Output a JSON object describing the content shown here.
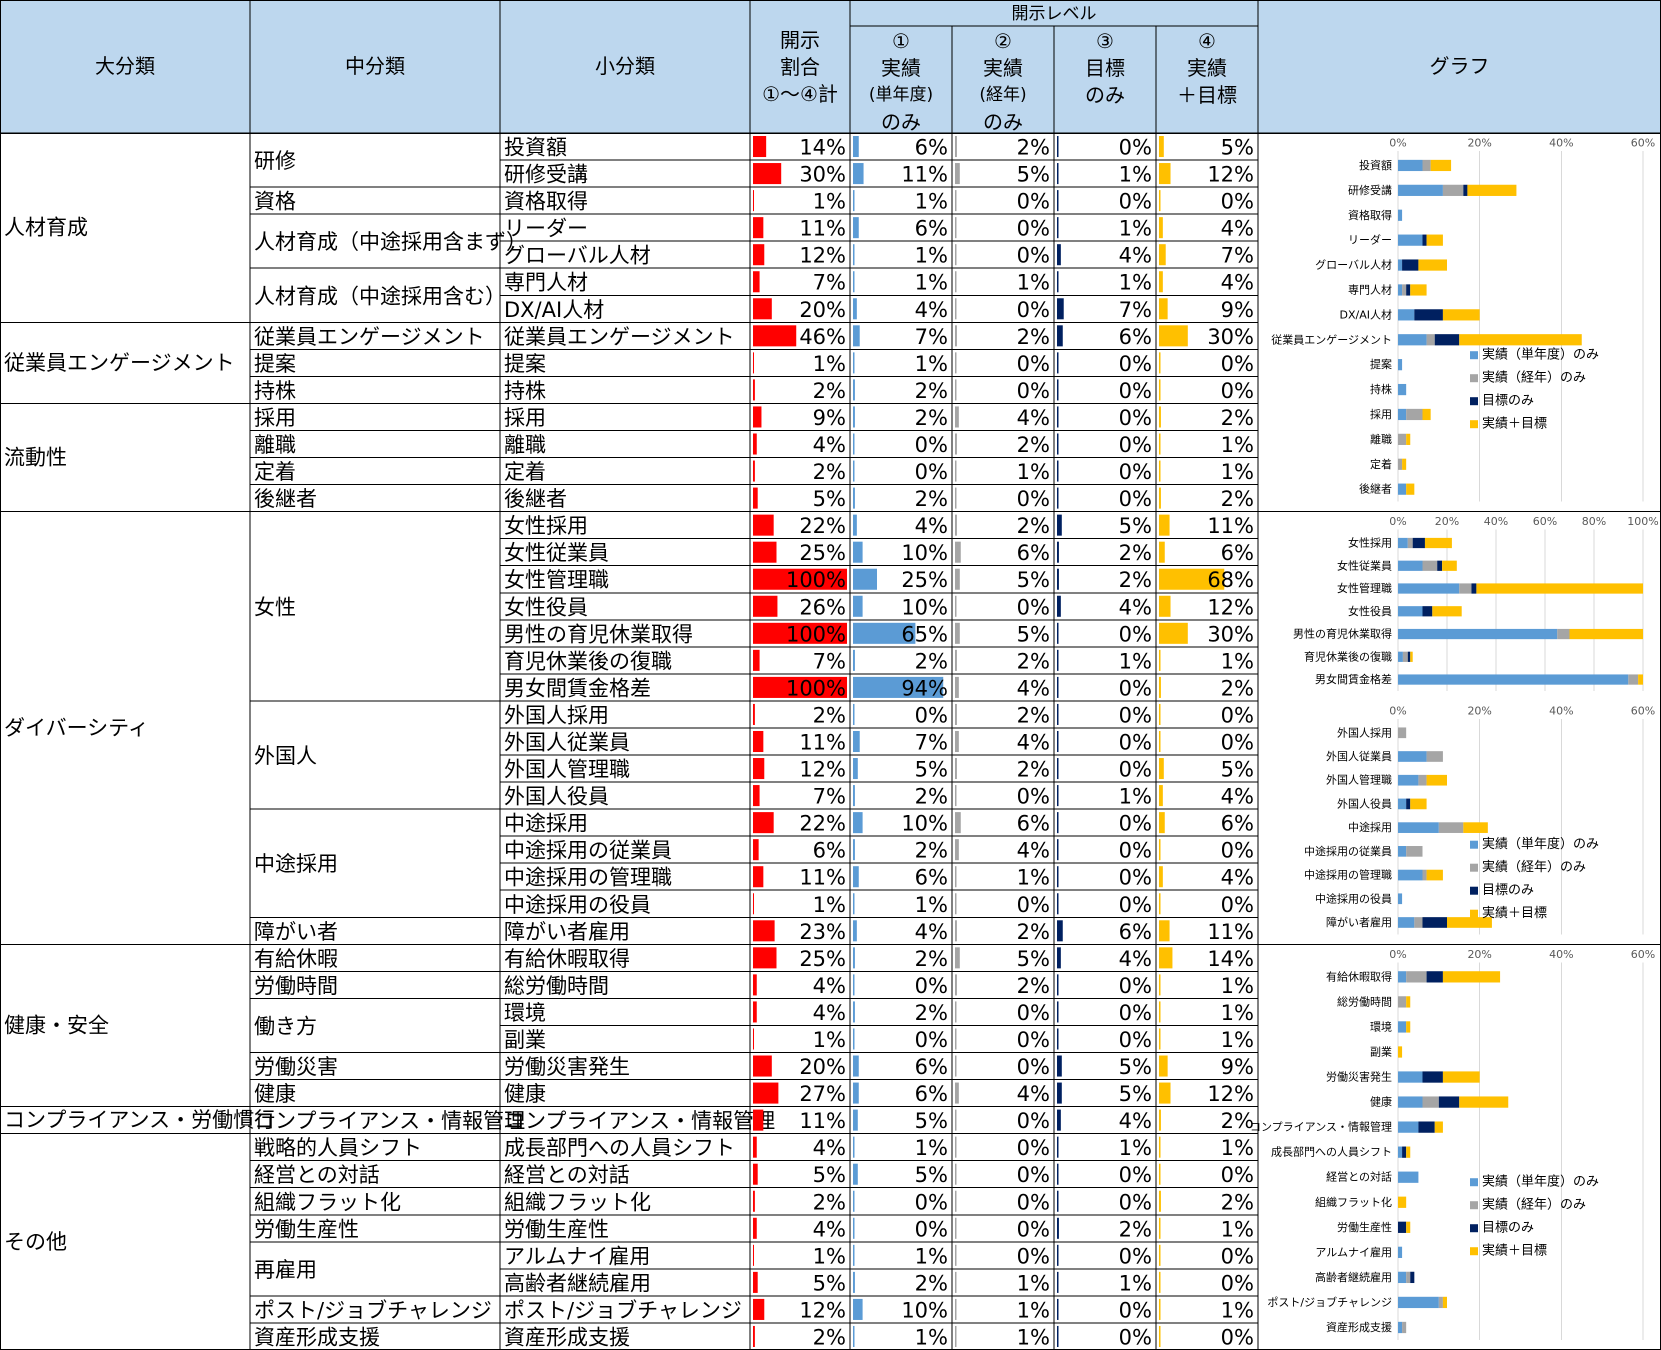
{
  "header": {
    "dai": "大分類",
    "chu": "中分類",
    "sho": "小分類",
    "ratio": [
      "開示",
      "割合",
      "①～④計"
    ],
    "level_title": "開示レベル",
    "l1": [
      "①",
      "実績",
      "(単年度)",
      "のみ"
    ],
    "l2": [
      "②",
      "実績",
      "(経年)",
      "のみ"
    ],
    "l3": [
      "③",
      "目標",
      "のみ"
    ],
    "l4": [
      "④",
      "実績",
      "＋目標"
    ],
    "graph": "グラフ"
  },
  "colors": {
    "header_bg": "#BDD7EE",
    "ratio_bar": "#FF0000",
    "s1": "#5B9BD5",
    "s2": "#A5A5A5",
    "s3": "#002060",
    "s4": "#FFC000",
    "grid": "#D9D9D9"
  },
  "dai_groups": [
    {
      "label": "人材育成",
      "start": 0,
      "span": 7
    },
    {
      "label": "従業員エンゲージメント",
      "start": 7,
      "span": 3
    },
    {
      "label": "流動性",
      "start": 10,
      "span": 4
    },
    {
      "label": "ダイバーシティ",
      "start": 14,
      "span": 16
    },
    {
      "label": "健康・安全",
      "start": 30,
      "span": 6
    },
    {
      "label": "コンプライアンス・労働慣行",
      "start": 36,
      "span": 1
    },
    {
      "label": "その他",
      "start": 37,
      "span": 8
    }
  ],
  "chu_groups": [
    {
      "label": "研修",
      "start": 0,
      "span": 2
    },
    {
      "label": "資格",
      "start": 2,
      "span": 1
    },
    {
      "label": "人材育成（中途採用含まず）",
      "start": 3,
      "span": 2
    },
    {
      "label": "人材育成（中途採用含む）",
      "start": 5,
      "span": 2
    },
    {
      "label": "従業員エンゲージメント",
      "start": 7,
      "span": 1
    },
    {
      "label": "提案",
      "start": 8,
      "span": 1
    },
    {
      "label": "持株",
      "start": 9,
      "span": 1
    },
    {
      "label": "採用",
      "start": 10,
      "span": 1
    },
    {
      "label": "離職",
      "start": 11,
      "span": 1
    },
    {
      "label": "定着",
      "start": 12,
      "span": 1
    },
    {
      "label": "後継者",
      "start": 13,
      "span": 1
    },
    {
      "label": "女性",
      "start": 14,
      "span": 7
    },
    {
      "label": "外国人",
      "start": 21,
      "span": 4
    },
    {
      "label": "中途採用",
      "start": 25,
      "span": 4
    },
    {
      "label": "障がい者",
      "start": 29,
      "span": 1
    },
    {
      "label": "有給休暇",
      "start": 30,
      "span": 1
    },
    {
      "label": "労働時間",
      "start": 31,
      "span": 1
    },
    {
      "label": "働き方",
      "start": 32,
      "span": 2
    },
    {
      "label": "労働災害",
      "start": 34,
      "span": 1
    },
    {
      "label": "健康",
      "start": 35,
      "span": 1
    },
    {
      "label": "コンプライアンス・情報管理",
      "start": 36,
      "span": 1
    },
    {
      "label": "戦略的人員シフト",
      "start": 37,
      "span": 1
    },
    {
      "label": "経営との対話",
      "start": 38,
      "span": 1
    },
    {
      "label": "組織フラット化",
      "start": 39,
      "span": 1
    },
    {
      "label": "労働生産性",
      "start": 40,
      "span": 1
    },
    {
      "label": "再雇用",
      "start": 41,
      "span": 2
    },
    {
      "label": "ポスト/ジョブチャレンジ",
      "start": 43,
      "span": 1
    },
    {
      "label": "資産形成支援",
      "start": 44,
      "span": 1
    }
  ],
  "chart_data": {
    "type": "table",
    "columns": [
      "小分類",
      "開示割合①～④計",
      "①実績(単年度)のみ",
      "②実績(経年)のみ",
      "③目標のみ",
      "④実績＋目標"
    ],
    "rows": [
      {
        "name": "投資額",
        "ratio": 14,
        "l1": 6,
        "l2": 2,
        "l3": 0,
        "l4": 5
      },
      {
        "name": "研修受講",
        "ratio": 30,
        "l1": 11,
        "l2": 5,
        "l3": 1,
        "l4": 12
      },
      {
        "name": "資格取得",
        "ratio": 1,
        "l1": 1,
        "l2": 0,
        "l3": 0,
        "l4": 0
      },
      {
        "name": "リーダー",
        "ratio": 11,
        "l1": 6,
        "l2": 0,
        "l3": 1,
        "l4": 4
      },
      {
        "name": "グローバル人材",
        "ratio": 12,
        "l1": 1,
        "l2": 0,
        "l3": 4,
        "l4": 7
      },
      {
        "name": "専門人材",
        "ratio": 7,
        "l1": 1,
        "l2": 1,
        "l3": 1,
        "l4": 4
      },
      {
        "name": "DX/AI人材",
        "ratio": 20,
        "l1": 4,
        "l2": 0,
        "l3": 7,
        "l4": 9
      },
      {
        "name": "従業員エンゲージメント",
        "ratio": 46,
        "l1": 7,
        "l2": 2,
        "l3": 6,
        "l4": 30
      },
      {
        "name": "提案",
        "ratio": 1,
        "l1": 1,
        "l2": 0,
        "l3": 0,
        "l4": 0
      },
      {
        "name": "持株",
        "ratio": 2,
        "l1": 2,
        "l2": 0,
        "l3": 0,
        "l4": 0
      },
      {
        "name": "採用",
        "ratio": 9,
        "l1": 2,
        "l2": 4,
        "l3": 0,
        "l4": 2
      },
      {
        "name": "離職",
        "ratio": 4,
        "l1": 0,
        "l2": 2,
        "l3": 0,
        "l4": 1
      },
      {
        "name": "定着",
        "ratio": 2,
        "l1": 0,
        "l2": 1,
        "l3": 0,
        "l4": 1
      },
      {
        "name": "後継者",
        "ratio": 5,
        "l1": 2,
        "l2": 0,
        "l3": 0,
        "l4": 2
      },
      {
        "name": "女性採用",
        "ratio": 22,
        "l1": 4,
        "l2": 2,
        "l3": 5,
        "l4": 11
      },
      {
        "name": "女性従業員",
        "ratio": 25,
        "l1": 10,
        "l2": 6,
        "l3": 2,
        "l4": 6
      },
      {
        "name": "女性管理職",
        "ratio": 100,
        "l1": 25,
        "l2": 5,
        "l3": 2,
        "l4": 68
      },
      {
        "name": "女性役員",
        "ratio": 26,
        "l1": 10,
        "l2": 0,
        "l3": 4,
        "l4": 12
      },
      {
        "name": "男性の育児休業取得",
        "ratio": 100,
        "l1": 65,
        "l2": 5,
        "l3": 0,
        "l4": 30
      },
      {
        "name": "育児休業後の復職",
        "ratio": 7,
        "l1": 2,
        "l2": 2,
        "l3": 1,
        "l4": 1
      },
      {
        "name": "男女間賃金格差",
        "ratio": 100,
        "l1": 94,
        "l2": 4,
        "l3": 0,
        "l4": 2
      },
      {
        "name": "外国人採用",
        "ratio": 2,
        "l1": 0,
        "l2": 2,
        "l3": 0,
        "l4": 0
      },
      {
        "name": "外国人従業員",
        "ratio": 11,
        "l1": 7,
        "l2": 4,
        "l3": 0,
        "l4": 0
      },
      {
        "name": "外国人管理職",
        "ratio": 12,
        "l1": 5,
        "l2": 2,
        "l3": 0,
        "l4": 5
      },
      {
        "name": "外国人役員",
        "ratio": 7,
        "l1": 2,
        "l2": 0,
        "l3": 1,
        "l4": 4
      },
      {
        "name": "中途採用",
        "ratio": 22,
        "l1": 10,
        "l2": 6,
        "l3": 0,
        "l4": 6
      },
      {
        "name": "中途採用の従業員",
        "ratio": 6,
        "l1": 2,
        "l2": 4,
        "l3": 0,
        "l4": 0
      },
      {
        "name": "中途採用の管理職",
        "ratio": 11,
        "l1": 6,
        "l2": 1,
        "l3": 0,
        "l4": 4
      },
      {
        "name": "中途採用の役員",
        "ratio": 1,
        "l1": 1,
        "l2": 0,
        "l3": 0,
        "l4": 0
      },
      {
        "name": "障がい者雇用",
        "ratio": 23,
        "l1": 4,
        "l2": 2,
        "l3": 6,
        "l4": 11
      },
      {
        "name": "有給休暇取得",
        "ratio": 25,
        "l1": 2,
        "l2": 5,
        "l3": 4,
        "l4": 14
      },
      {
        "name": "総労働時間",
        "ratio": 4,
        "l1": 0,
        "l2": 2,
        "l3": 0,
        "l4": 1
      },
      {
        "name": "環境",
        "ratio": 4,
        "l1": 2,
        "l2": 0,
        "l3": 0,
        "l4": 1
      },
      {
        "name": "副業",
        "ratio": 1,
        "l1": 0,
        "l2": 0,
        "l3": 0,
        "l4": 1
      },
      {
        "name": "労働災害発生",
        "ratio": 20,
        "l1": 6,
        "l2": 0,
        "l3": 5,
        "l4": 9
      },
      {
        "name": "健康",
        "ratio": 27,
        "l1": 6,
        "l2": 4,
        "l3": 5,
        "l4": 12
      },
      {
        "name": "コンプライアンス・情報管理",
        "ratio": 11,
        "l1": 5,
        "l2": 0,
        "l3": 4,
        "l4": 2
      },
      {
        "name": "成長部門への人員シフト",
        "ratio": 4,
        "l1": 1,
        "l2": 0,
        "l3": 1,
        "l4": 1
      },
      {
        "name": "経営との対話",
        "ratio": 5,
        "l1": 5,
        "l2": 0,
        "l3": 0,
        "l4": 0
      },
      {
        "name": "組織フラット化",
        "ratio": 2,
        "l1": 0,
        "l2": 0,
        "l3": 0,
        "l4": 2
      },
      {
        "name": "労働生産性",
        "ratio": 4,
        "l1": 0,
        "l2": 0,
        "l3": 2,
        "l4": 1
      },
      {
        "name": "アルムナイ雇用",
        "ratio": 1,
        "l1": 1,
        "l2": 0,
        "l3": 0,
        "l4": 0
      },
      {
        "name": "高齢者継続雇用",
        "ratio": 5,
        "l1": 2,
        "l2": 1,
        "l3": 1,
        "l4": 0
      },
      {
        "name": "ポスト/ジョブチャレンジ",
        "ratio": 12,
        "l1": 10,
        "l2": 1,
        "l3": 0,
        "l4": 1
      },
      {
        "name": "資産形成支援",
        "ratio": 2,
        "l1": 1,
        "l2": 1,
        "l3": 0,
        "l4": 0
      }
    ],
    "mini_charts": [
      {
        "type": "bar",
        "stacked": true,
        "orientation": "horizontal",
        "row_start": 0,
        "row_end": 14,
        "xlim": [
          0,
          60
        ],
        "ticks": [
          "0%",
          "20%",
          "40%",
          "60%"
        ],
        "tick_values": [
          0,
          20,
          40,
          60
        ],
        "categories": [
          "投資額",
          "研修受講",
          "資格取得",
          "リーダー",
          "グローバル人材",
          "専門人材",
          "DX/AI人材",
          "従業員エンゲージメント",
          "提案",
          "持株",
          "採用",
          "離職",
          "定着",
          "後継者"
        ],
        "legend": [
          "実績（単年度）のみ",
          "実績（経年）のみ",
          "目標のみ",
          "実績＋目標"
        ],
        "legend_position": "right"
      },
      {
        "type": "bar",
        "stacked": true,
        "orientation": "horizontal",
        "row_start": 14,
        "row_end": 21,
        "xlim": [
          0,
          100
        ],
        "ticks": [
          "0%",
          "20%",
          "40%",
          "60%",
          "80%",
          "100%"
        ],
        "tick_values": [
          0,
          20,
          40,
          60,
          80,
          100
        ],
        "categories": [
          "女性採用",
          "女性従業員",
          "女性管理職",
          "女性役員",
          "男性の育児休業取得",
          "育児休業後の復職",
          "男女間賃金格差"
        ],
        "legend": [],
        "legend_position": "none"
      },
      {
        "type": "bar",
        "stacked": true,
        "orientation": "horizontal",
        "row_start": 21,
        "row_end": 30,
        "xlim": [
          0,
          60
        ],
        "ticks": [
          "0%",
          "20%",
          "40%",
          "60%"
        ],
        "tick_values": [
          0,
          20,
          40,
          60
        ],
        "categories": [
          "外国人採用",
          "外国人従業員",
          "外国人管理職",
          "外国人役員",
          "中途採用",
          "中途採用の従業員",
          "中途採用の管理職",
          "中途採用の役員",
          "障がい者雇用"
        ],
        "legend": [
          "実績（単年度）のみ",
          "実績（経年）のみ",
          "目標のみ",
          "実績＋目標"
        ],
        "legend_position": "right"
      },
      {
        "type": "bar",
        "stacked": true,
        "orientation": "horizontal",
        "row_start": 30,
        "row_end": 45,
        "xlim": [
          0,
          60
        ],
        "ticks": [
          "0%",
          "20%",
          "40%",
          "60%"
        ],
        "tick_values": [
          0,
          20,
          40,
          60
        ],
        "categories": [
          "有給休暇取得",
          "総労働時間",
          "環境",
          "副業",
          "労働災害発生",
          "健康",
          "コンプライアンス・情報管理",
          "成長部門への人員シフト",
          "経営との対話",
          "組織フラット化",
          "労働生産性",
          "アルムナイ雇用",
          "高齢者継続雇用",
          "ポスト/ジョブチャレンジ",
          "資産形成支援"
        ],
        "legend": [
          "実績（単年度）のみ",
          "実績（経年）のみ",
          "目標のみ",
          "実績＋目標"
        ],
        "legend_position": "right"
      }
    ]
  }
}
